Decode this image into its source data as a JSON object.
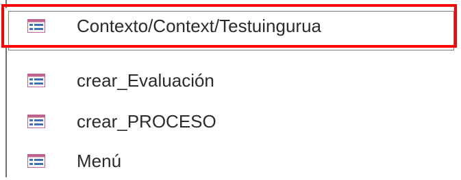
{
  "nav_pane": {
    "items": [
      {
        "label": "Contexto/Context/Testuingurua",
        "icon": "form-icon",
        "selected": true
      },
      {
        "label": "crear_Evaluación",
        "icon": "form-icon",
        "selected": false
      },
      {
        "label": "crear_PROCESO",
        "icon": "form-icon",
        "selected": false
      },
      {
        "label": "Menú",
        "icon": "form-icon",
        "selected": false
      }
    ]
  },
  "colors": {
    "highlight": "#ff0000",
    "icon_header": "#c0608c",
    "icon_body": "#3f6fb5",
    "text": "#2b2b2b"
  }
}
